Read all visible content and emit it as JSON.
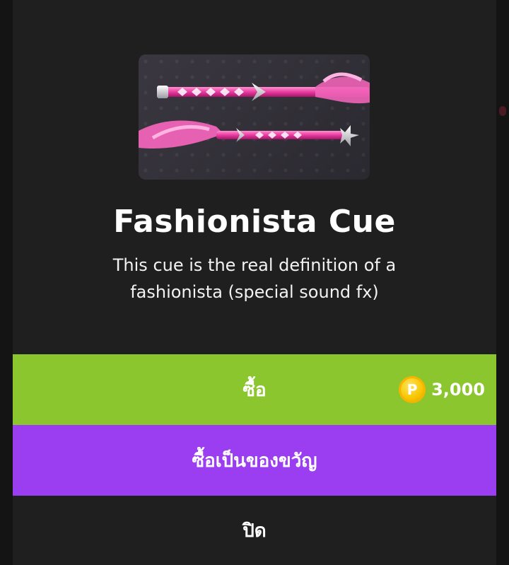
{
  "item": {
    "name": "Fashionista Cue",
    "description_line1": "This cue is the real definition of a",
    "description_line2": "fashionista (special sound fx)",
    "preview_icon": "cue-preview-image"
  },
  "actions": {
    "buy_label": "ซื้อ",
    "price": "3,000",
    "currency_icon": "coin-icon",
    "currency_letter": "P",
    "gift_label": "ซื้อเป็นของขวัญ",
    "close_label": "ปิด"
  },
  "colors": {
    "buy": "#8cc62f",
    "gift": "#9b3df0",
    "dialog": "#1f1f1f",
    "coin": "#f7c500"
  }
}
